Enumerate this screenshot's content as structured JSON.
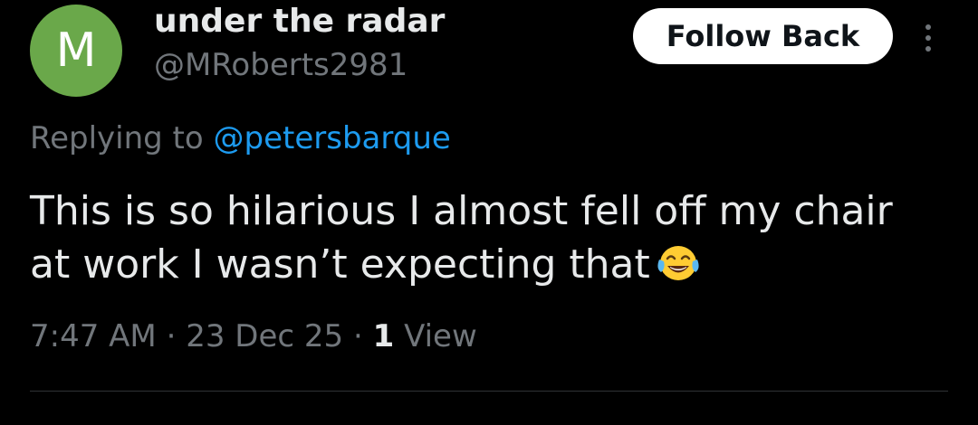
{
  "author": {
    "avatar_letter": "M",
    "avatar_color": "#6aa84a",
    "display_name": "under the radar",
    "handle": "@MRoberts2981"
  },
  "actions": {
    "follow_label": "Follow Back",
    "more_icon": "more-vertical-icon"
  },
  "reply": {
    "prefix": "Replying to",
    "mention": "@petersbarque"
  },
  "tweet": {
    "text": "This is so hilarious I almost fell off my chair at work I wasn’t expecting that",
    "emoji": "face-with-tears-of-joy-icon"
  },
  "meta": {
    "time": "7:47 AM",
    "separator1": "·",
    "date": "23 Dec 25",
    "separator2": "·",
    "view_count": "1",
    "view_label": "View"
  },
  "colors": {
    "background": "#000000",
    "text": "#e7e9ea",
    "muted": "#71767b",
    "link": "#1d9bf0",
    "divider": "#2f3336"
  }
}
